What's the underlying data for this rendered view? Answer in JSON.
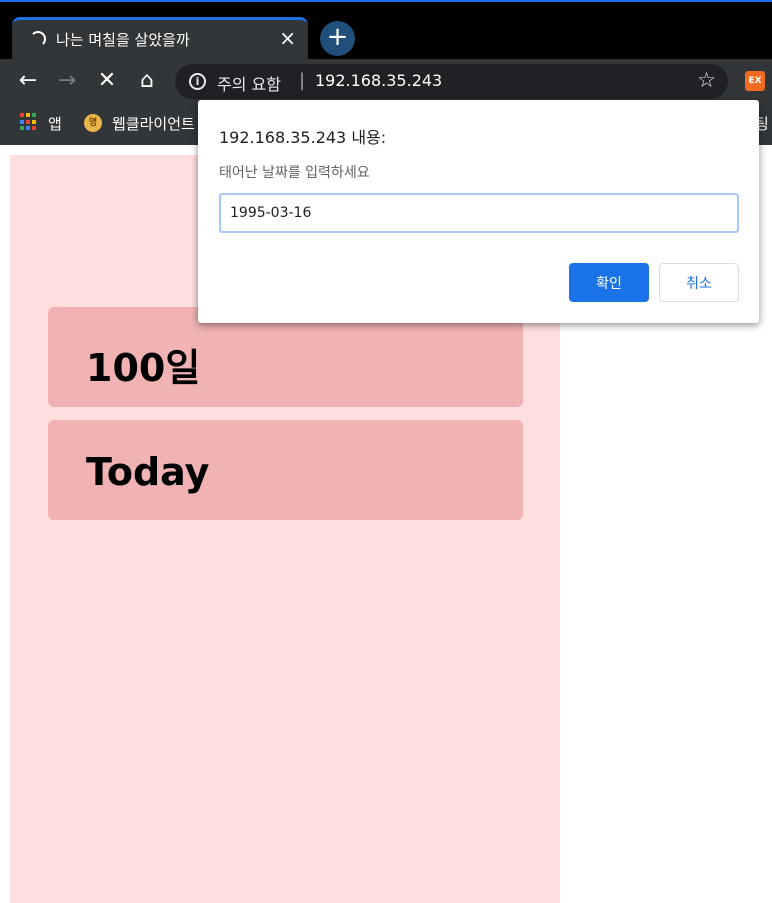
{
  "browser": {
    "tab": {
      "title": "나는 며칠을 살았을까",
      "close_icon": "×"
    },
    "new_tab_icon": "+",
    "toolbar": {
      "back_icon": "←",
      "forward_icon": "→",
      "stop_icon": "✕",
      "home_icon": "⌂",
      "security_label": "주의 요함",
      "separator": "|",
      "url": "192.168.35.243",
      "bookmark_star_icon": "☆",
      "extension_label": "EX"
    },
    "bookmarks": {
      "apps_label": "앱",
      "items": [
        {
          "favicon": "명",
          "label": "웹클라이언트"
        }
      ],
      "overflow_label": "팅"
    }
  },
  "page": {
    "cards": [
      {
        "label": "100일"
      },
      {
        "label": "Today"
      }
    ],
    "colors": {
      "panel_background": "#ffdede",
      "card_background": "#f0b2b2"
    }
  },
  "dialog": {
    "title": "192.168.35.243 내용:",
    "message": "태어난 날짜를 입력하세요",
    "input_value": "1995-03-16",
    "ok_label": "확인",
    "cancel_label": "취소"
  }
}
